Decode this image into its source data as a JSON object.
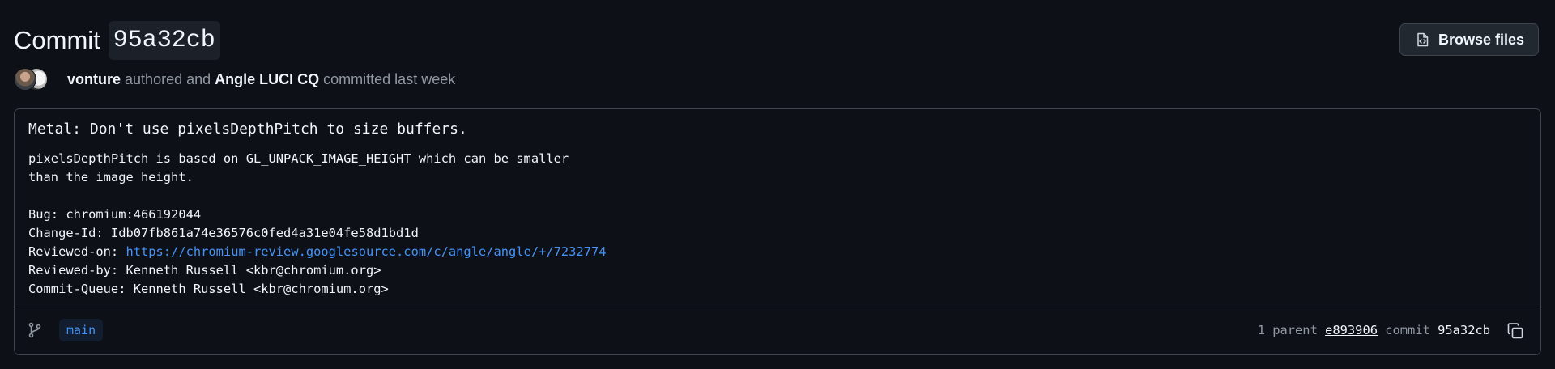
{
  "header": {
    "title_word": "Commit",
    "short_sha": "95a32cb",
    "browse_files_label": "Browse files"
  },
  "meta": {
    "author": "vonture",
    "authored_text": "authored and",
    "committer": "Angle LUCI CQ",
    "committed_text": "committed last week"
  },
  "message": {
    "title": "Metal: Don't use pixelsDepthPitch to size buffers.",
    "body_line1": "pixelsDepthPitch is based on GL_UNPACK_IMAGE_HEIGHT which can be smaller",
    "body_line2": "than the image height.",
    "bug": "Bug: chromium:466192044",
    "change_id": "Change-Id: Idb07fb861a74e36576c0fed4a31e04fe58d1bd1d",
    "reviewed_on_label": "Reviewed-on: ",
    "reviewed_on_url": "https://chromium-review.googlesource.com/c/angle/angle/+/7232774",
    "reviewed_by": "Reviewed-by: Kenneth Russell <kbr@chromium.org>",
    "commit_queue": "Commit-Queue: Kenneth Russell <kbr@chromium.org>"
  },
  "footer": {
    "branch": "main",
    "parent_label": "1 parent ",
    "parent_sha": "e893906",
    "commit_label": " commit ",
    "commit_sha": "95a32cb"
  },
  "icons": {
    "browse": "file-code-icon",
    "branch": "git-branch-icon",
    "copy": "copy-icon"
  },
  "colors": {
    "background": "#0d1117",
    "border": "#3d444d",
    "link": "#4493f8",
    "muted": "#9198a1",
    "text": "#f0f6fc"
  }
}
